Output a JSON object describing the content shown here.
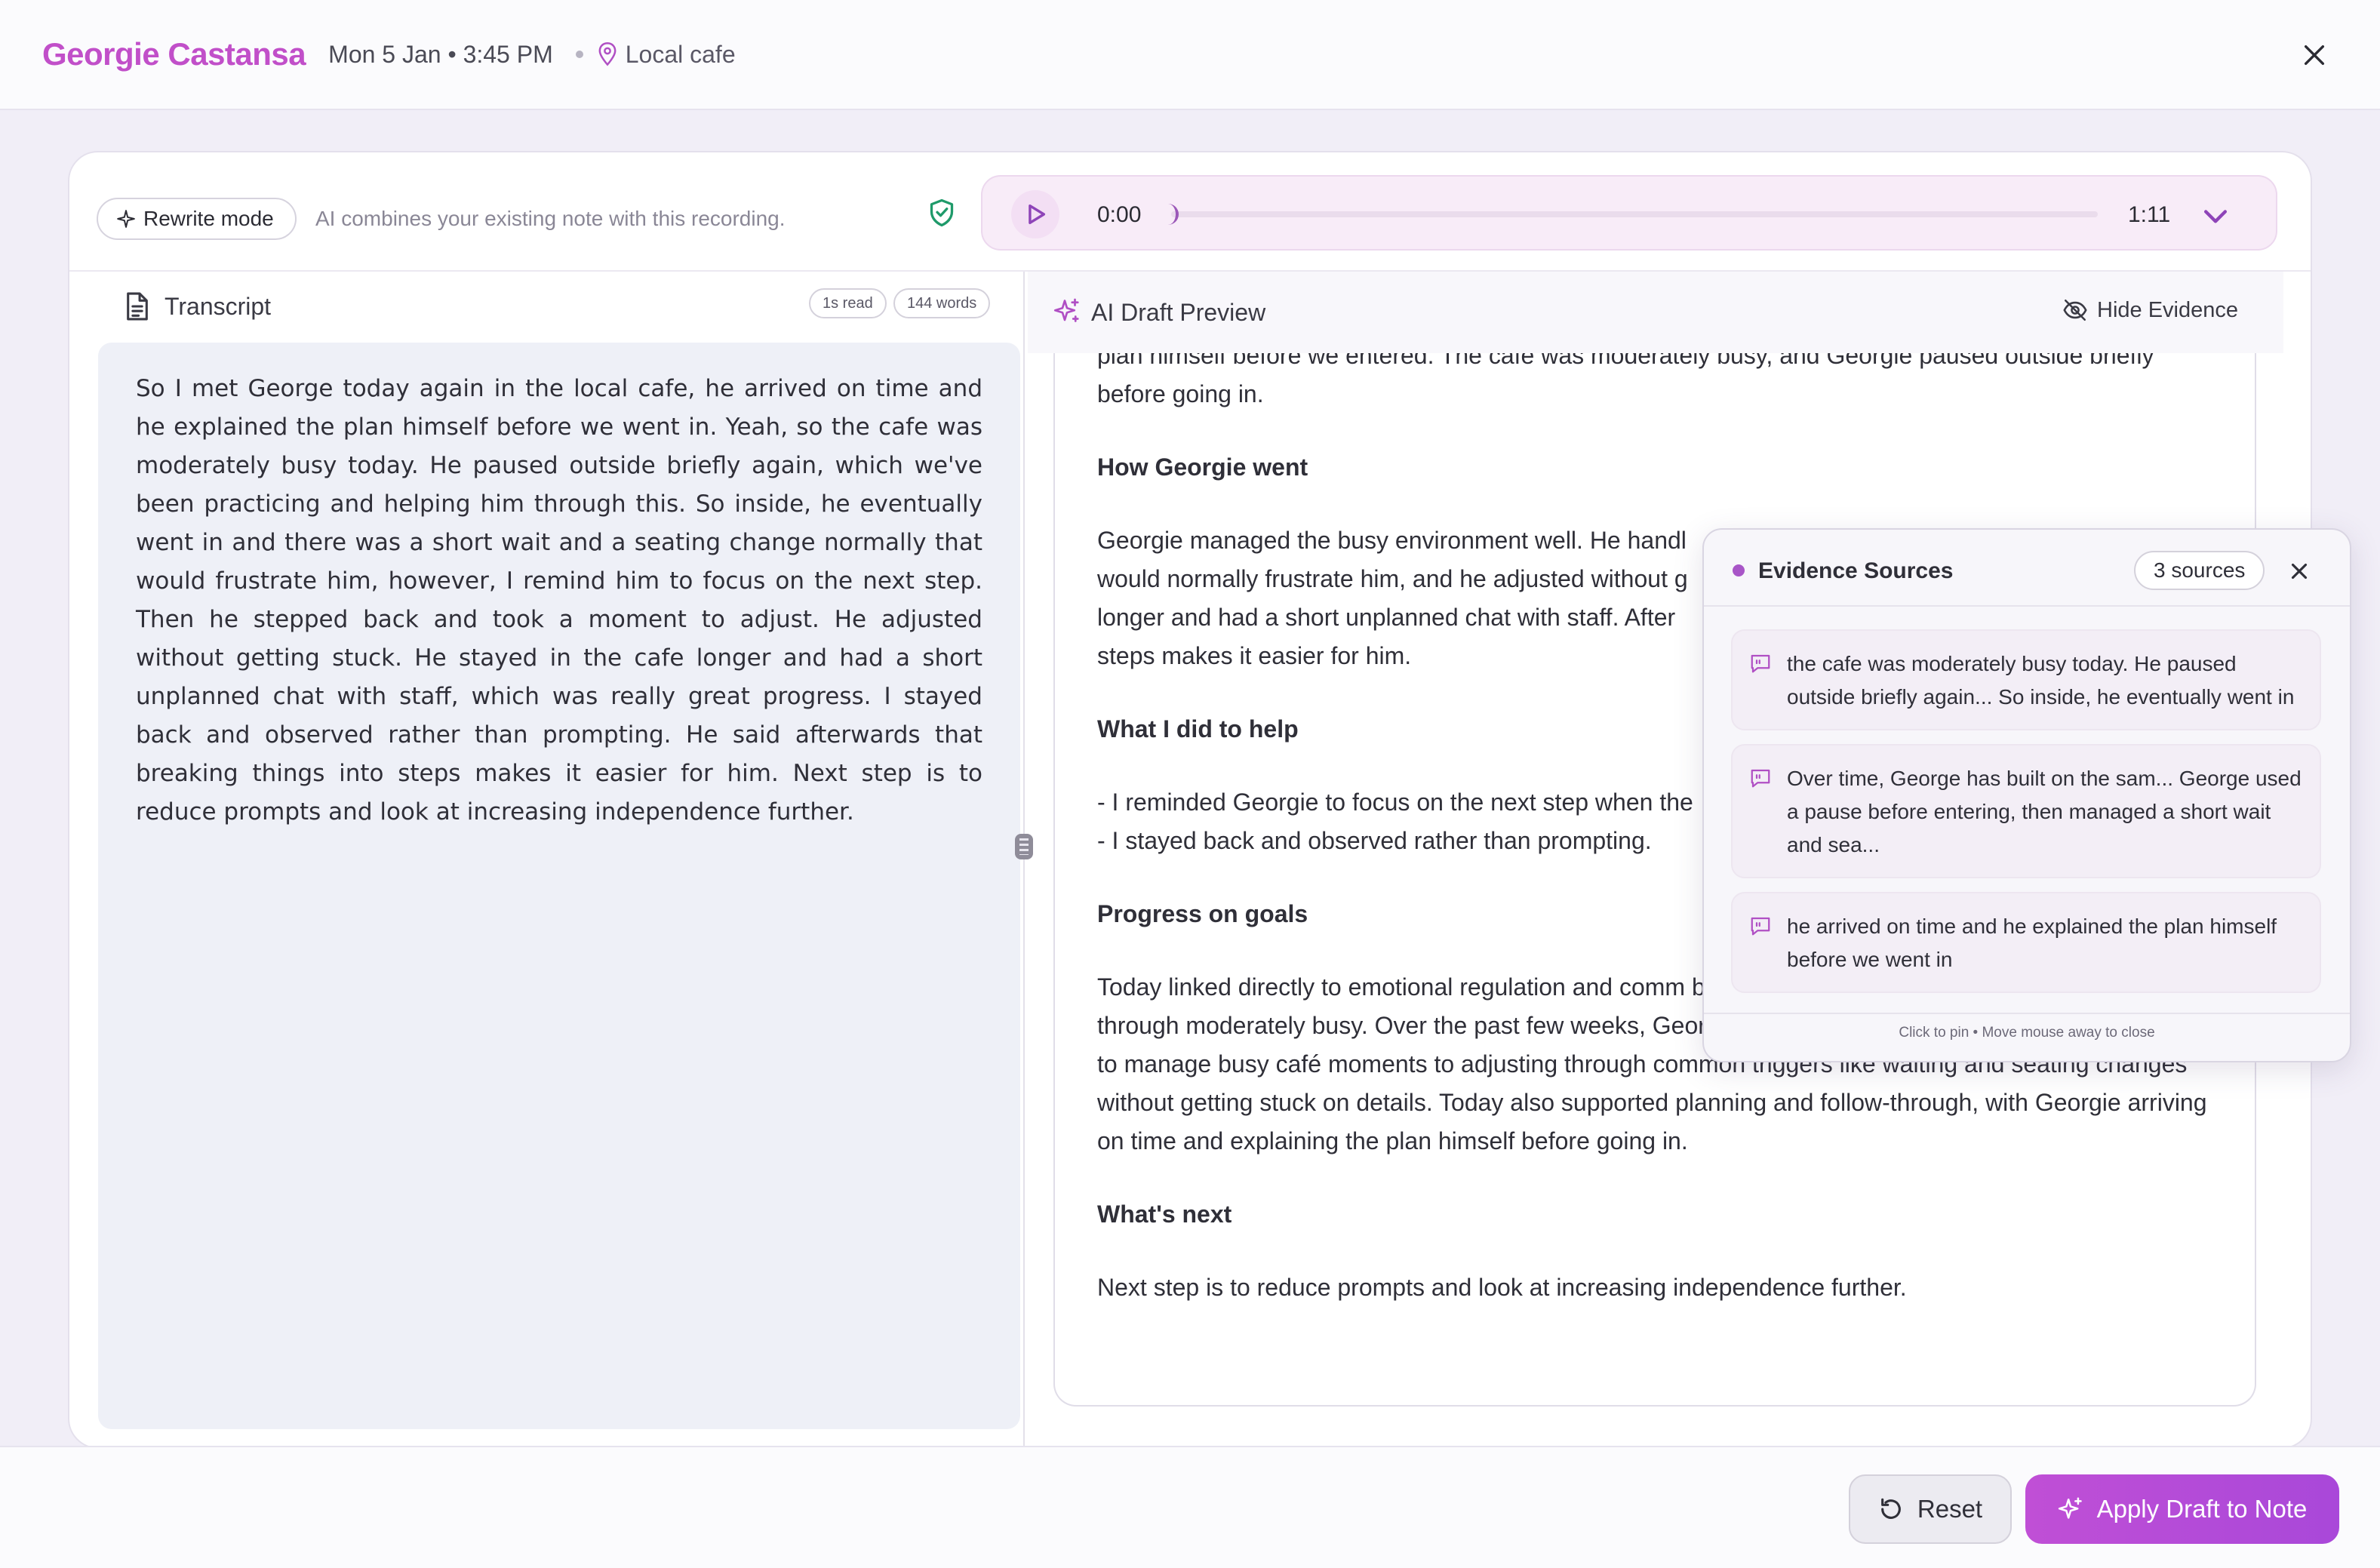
{
  "header": {
    "client_name": "Georgie Castansa",
    "datetime": "Mon 5 Jan • 3:45 PM",
    "location": "Local cafe"
  },
  "toolbar": {
    "rewrite_label": "Rewrite mode",
    "rewrite_hint": "AI combines your existing note with this recording."
  },
  "player": {
    "current_time": "0:00",
    "total_time": "1:11",
    "progress": 0
  },
  "transcript": {
    "title": "Transcript",
    "read_time": "1s read",
    "word_count": "144 words",
    "text": "So I met George today again in the local cafe, he arrived on time and he explained the plan himself before we went in. Yeah, so the cafe was moderately busy today. He paused outside briefly again, which we've been practicing and helping him through this. So inside, he eventually went in and there was a short wait and a seating change normally that would frustrate him, however, I remind him to focus on the next step. Then he stepped back and took a moment to adjust. He adjusted without getting stuck. He stayed in the cafe longer and had a short unplanned chat with staff, which was really great progress. I stayed back and observed rather than prompting. He said afterwards that breaking things into steps makes it easier for him. Next step is to reduce prompts and look at increasing independence further."
  },
  "preview": {
    "title": "AI Draft Preview",
    "hide_evidence_label": "Hide Evidence",
    "intro": "plan himself before we entered.  The cafe was moderately busy, and Georgie paused outside briefly before going in.",
    "h_went": "How Georgie went",
    "p_went": "Georgie managed the busy environment well.  He handl would normally frustrate him, and he adjusted without g longer and had a short unplanned chat with staff.  After steps makes it easier for him.",
    "h_help": "What I did to help",
    "help_1": "- I reminded Georgie to focus on the next step when the",
    "help_2": "- I stayed back and observed rather than prompting.",
    "h_progress": "Progress on goals",
    "p_progress": "Today linked directly to emotional regulation and comm before entering” strategy again, then followed through moderately busy.  Over the past few weeks, Georgie has progressed from needing more support to manage busy café moments to adjusting through common triggers like waiting and seating changes without getting stuck on details.  Today also supported planning and follow-through, with Georgie arriving on time and explaining the plan himself before going in.",
    "h_next": "What's next",
    "p_next": "Next step is to reduce prompts and look at increasing independence further."
  },
  "evidence": {
    "title": "Evidence Sources",
    "count_label": "3 sources",
    "items": [
      "the cafe was moderately busy today. He paused outside briefly again... So inside, he eventually went in",
      "Over time, George has built on the sam... George used a pause before entering, then managed a short wait and sea...",
      "he arrived on time and he explained the plan himself before we went in"
    ],
    "footer": "Click to pin • Move mouse away to close"
  },
  "actions": {
    "reset_label": "Reset",
    "apply_label": "Apply Draft to Note"
  },
  "colors": {
    "accent": "#c14fc9",
    "apply_button": "#b54cd8",
    "shield": "#1f9a6a"
  }
}
